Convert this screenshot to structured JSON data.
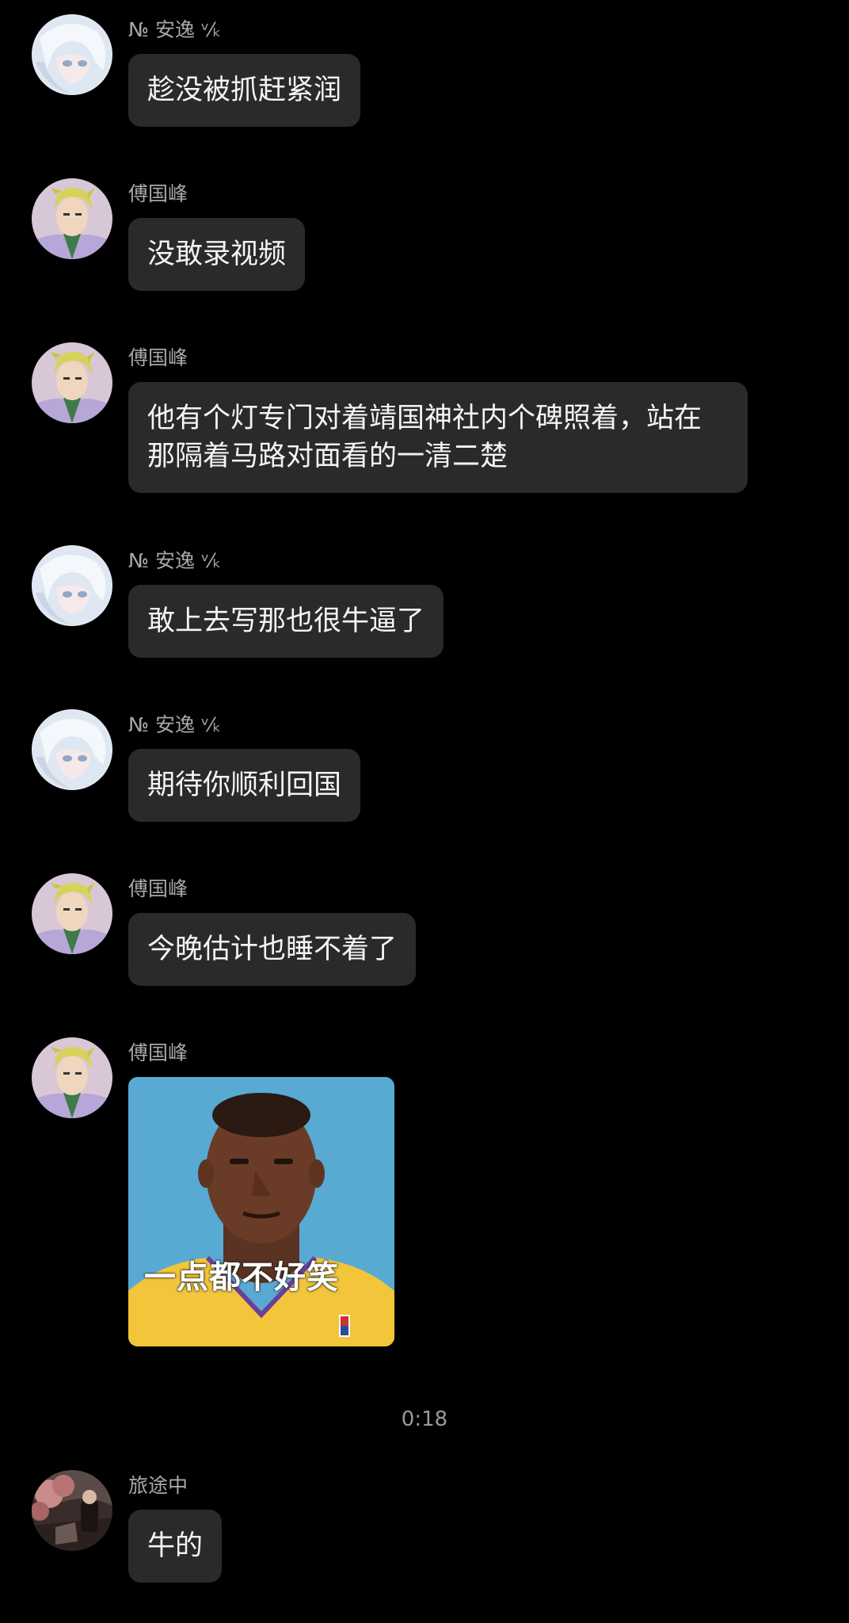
{
  "messages": [
    {
      "sender": "№ 安逸 ᵛ⁄ₖ",
      "text": "趁没被抓赶紧润"
    },
    {
      "sender": "傅国峰",
      "text": "没敢录视频"
    },
    {
      "sender": "傅国峰",
      "text": "他有个灯专门对着靖国神社内个碑照着，站在那隔着马路对面看的一清二楚"
    },
    {
      "sender": "№ 安逸 ᵛ⁄ₖ",
      "text": "敢上去写那也很牛逼了"
    },
    {
      "sender": "№ 安逸 ᵛ⁄ₖ",
      "text": "期待你顺利回国"
    },
    {
      "sender": "傅国峰",
      "text": "今晚估计也睡不着了"
    },
    {
      "sender": "傅国峰",
      "image_caption": "一点都不好笑"
    },
    {
      "sender": "旅途中",
      "text": "牛的"
    }
  ],
  "timestamp": "0:18",
  "colors": {
    "background": "#000000",
    "bubble": "#2a2a2a",
    "name": "#a8a8a8",
    "text": "#f4f4f4"
  }
}
